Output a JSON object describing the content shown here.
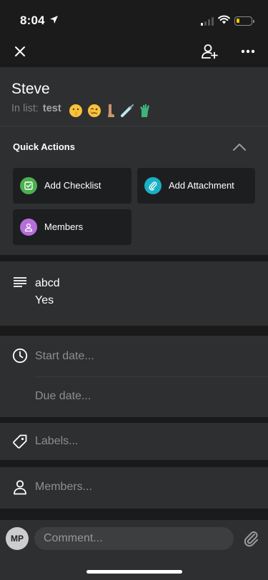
{
  "status_bar": {
    "time": "8:04"
  },
  "card": {
    "title": "Steve",
    "list_prefix": "In list:",
    "list_name": "test",
    "emojis": [
      "shushing-face-emoji",
      "woozy-face-emoji",
      "leg-emoji",
      "syringe-emoji",
      "glove-emoji"
    ]
  },
  "quick_actions": {
    "title": "Quick Actions",
    "buttons": [
      {
        "label": "Add Checklist",
        "icon": "checklist-icon",
        "color": "#4caf50"
      },
      {
        "label": "Add Attachment",
        "icon": "paperclip-icon",
        "color": "#1ab0c4"
      },
      {
        "label": "Members",
        "icon": "person-icon",
        "color": "#b66fd9"
      }
    ]
  },
  "description": {
    "line1": "abcd",
    "line2": "Yes"
  },
  "dates": {
    "start_placeholder": "Start date...",
    "due_placeholder": "Due date..."
  },
  "labels": {
    "placeholder": "Labels..."
  },
  "members": {
    "placeholder": "Members..."
  },
  "comment": {
    "avatar_initials": "MP",
    "placeholder": "Comment..."
  },
  "colors": {
    "background": "#1a1a1a",
    "surface": "#2e2f31",
    "button": "#1d1e20",
    "muted_text": "#8d8e91"
  }
}
